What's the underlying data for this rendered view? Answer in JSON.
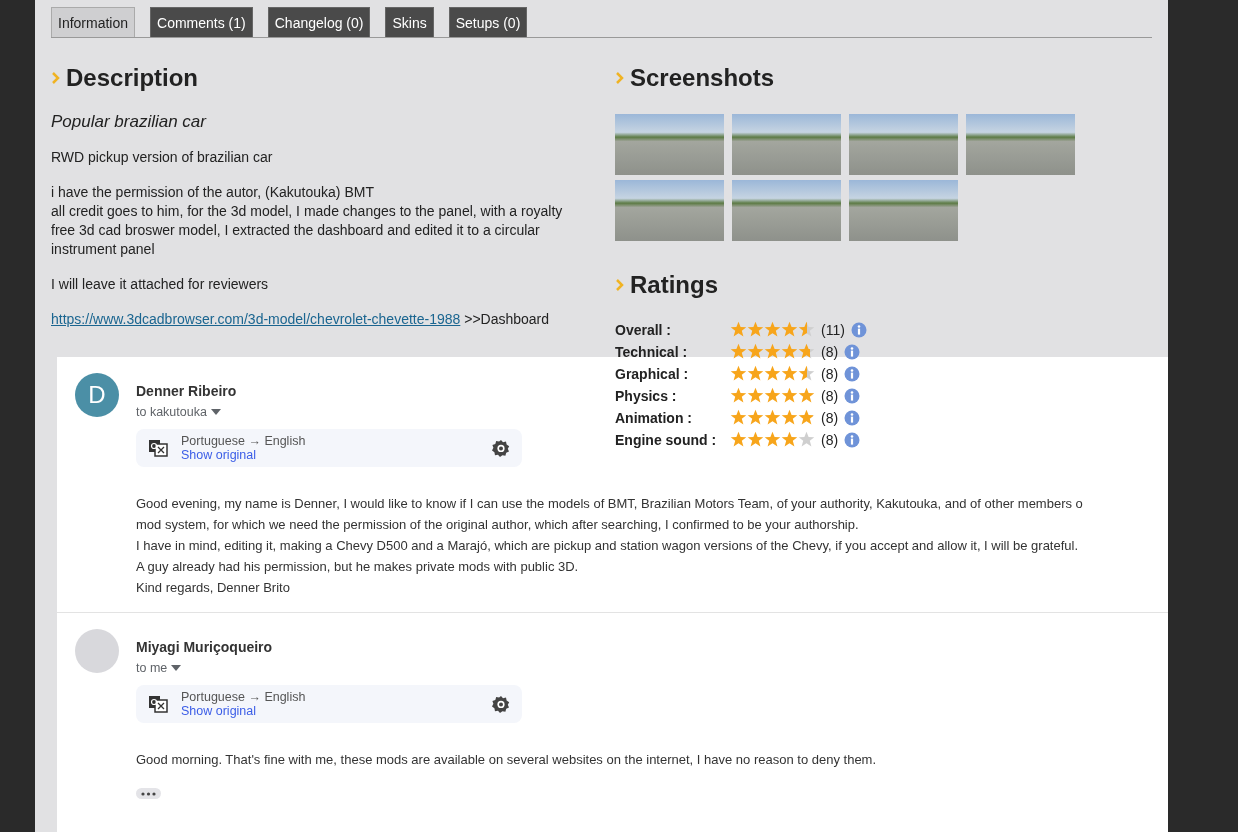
{
  "tabs": [
    {
      "label": "Information",
      "selected": true
    },
    {
      "label": "Comments (1)",
      "selected": false
    },
    {
      "label": "Changelog (0)",
      "selected": false
    },
    {
      "label": "Skins",
      "selected": false
    },
    {
      "label": "Setups (0)",
      "selected": false
    }
  ],
  "description": {
    "title": "Description",
    "subtitle": "Popular brazilian car",
    "paragraphs": [
      {
        "kind": "text",
        "lines": [
          "RWD pickup version of brazilian car"
        ]
      },
      {
        "kind": "text",
        "lines": [
          "i have the permission of the autor, (Kakutouka) BMT",
          "all credit goes to him, for the 3d model, I made changes to the panel, with a royalty free 3d cad broswer model, I extracted the dashboard and edited it to a circular instrument panel"
        ]
      },
      {
        "kind": "text",
        "lines": [
          "I will leave it attached for reviewers"
        ]
      },
      {
        "kind": "link",
        "link": "https://www.3dcadbrowser.com/3d-model/chevrolet-chevette-1988",
        "after": ">>Dashboard"
      }
    ]
  },
  "screenshots": {
    "title": "Screenshots",
    "items": [
      {
        "kind": "photo"
      },
      {
        "kind": "photo"
      },
      {
        "kind": "photo"
      },
      {
        "kind": "photo"
      },
      {
        "kind": "photo"
      },
      {
        "kind": "photo"
      },
      {
        "kind": "photo"
      }
    ]
  },
  "ratings": {
    "title": "Ratings",
    "rows": [
      {
        "label": "Overall :",
        "stars": 4.5,
        "count": "(11)"
      },
      {
        "label": "Technical :",
        "stars": 4.7,
        "count": "(8)"
      },
      {
        "label": "Graphical :",
        "stars": 4.5,
        "count": "(8)"
      },
      {
        "label": "Physics :",
        "stars": 5,
        "count": "(8)"
      },
      {
        "label": "Animation :",
        "stars": 4.9,
        "count": "(8)"
      },
      {
        "label": "Engine sound :",
        "stars": 4,
        "count": "(8)"
      }
    ]
  },
  "emails": [
    {
      "sender": "Denner Ribeiro",
      "avatar": {
        "kind": "letter",
        "letter": "D"
      },
      "recipient": "to kakutouka",
      "translation": {
        "languages": "Portuguese → English",
        "action": "Show original"
      },
      "body": [
        "Good evening, my name is Denner, I would like to know if I can use the models of BMT, Brazilian Motors Team, of your authority, Kakutouka, and of other members o",
        "mod system, for which we need the permission of the original author, which after searching, I confirmed to be your authorship.",
        "I have in mind, editing it, making a Chevy D500 and a Marajó, which are pickup and station wagon versions of the Chevy, if you accept and allow it, I will be grateful.",
        "A guy already had his permission, but he makes private mods with public 3D.",
        "Kind regards, Denner Brito"
      ],
      "more": false
    },
    {
      "sender": "Miyagi Muriçoqueiro",
      "avatar": {
        "kind": "photo"
      },
      "recipient": "to me",
      "translation": {
        "languages": "Portuguese → English",
        "action": "Show original"
      },
      "body": [
        "Good morning. That's fine with me, these mods are available on several websites on the internet, I have no reason to deny them."
      ],
      "more": true
    }
  ]
}
